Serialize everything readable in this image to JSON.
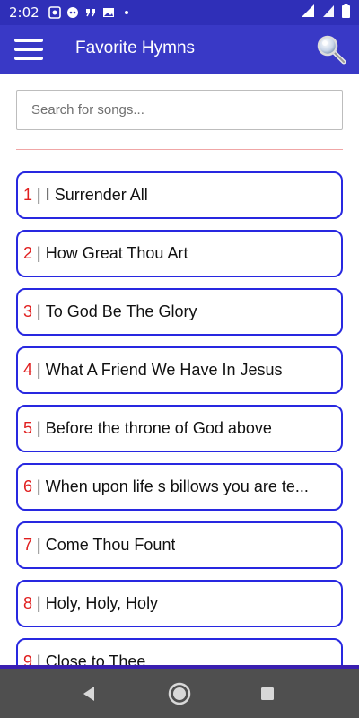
{
  "status_bar": {
    "time": "2:02"
  },
  "app_bar": {
    "title": "Favorite Hymns"
  },
  "search": {
    "placeholder": "Search for songs..."
  },
  "songs": [
    {
      "number": "1",
      "separator": " | ",
      "title": "I Surrender All"
    },
    {
      "number": "2",
      "separator": " | ",
      "title": "How Great Thou Art"
    },
    {
      "number": "3",
      "separator": " | ",
      "title": "To God Be The Glory"
    },
    {
      "number": "4",
      "separator": " | ",
      "title": "What A Friend We Have In Jesus"
    },
    {
      "number": "5",
      "separator": " | ",
      "title": "Before the throne of God above"
    },
    {
      "number": "6",
      "separator": " | ",
      "title": "When upon life s billows you are te..."
    },
    {
      "number": "7",
      "separator": " | ",
      "title": "Come Thou Fount"
    },
    {
      "number": "8",
      "separator": " | ",
      "title": "Holy, Holy, Holy"
    },
    {
      "number": "9",
      "separator": " | ",
      "title": "Close to Thee"
    }
  ],
  "colors": {
    "status_bar": "#2f2fb8",
    "app_bar": "#3939c6",
    "item_border": "#2828e0",
    "song_number": "#e01e1e",
    "divider": "#f0a6a6",
    "nav_bar": "#4f4f4f"
  },
  "icons": {
    "menu": "hamburger-menu-icon",
    "search": "magnifier-icon",
    "nav_back": "triangle-back-icon",
    "nav_home": "circle-home-icon",
    "nav_recent": "square-recent-icon"
  }
}
